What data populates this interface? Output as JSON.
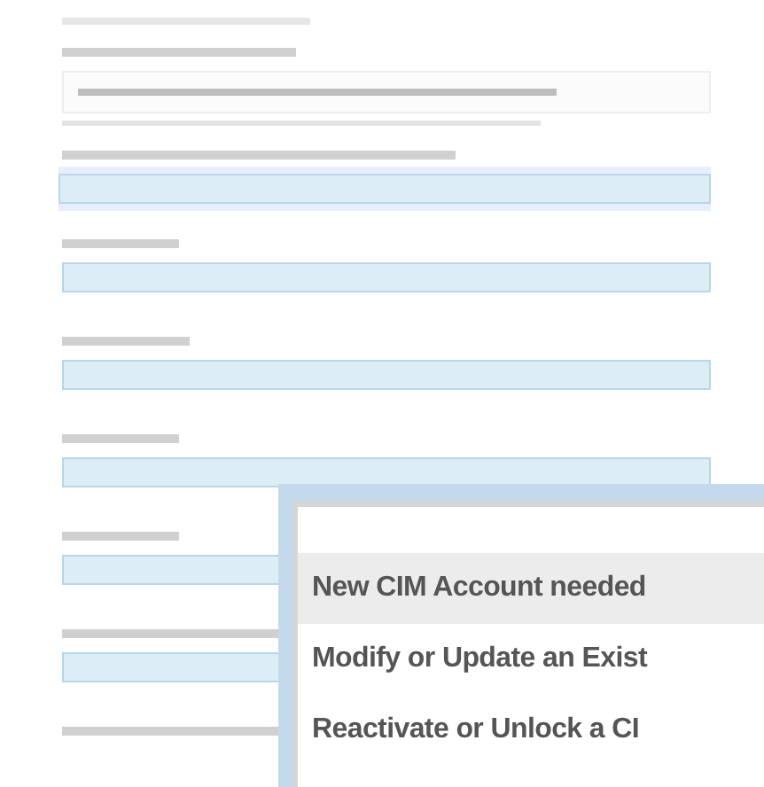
{
  "form": {
    "fields": [
      {
        "kind": "readonly"
      },
      {
        "kind": "focused"
      },
      {
        "kind": "input"
      },
      {
        "kind": "input"
      },
      {
        "kind": "input"
      },
      {
        "kind": "input"
      },
      {
        "kind": "input"
      },
      {
        "kind": "label"
      }
    ]
  },
  "dropdown": {
    "options": [
      {
        "label": "New CIM Account needed",
        "selected": true
      },
      {
        "label": "Modify or Update an Exist",
        "selected": false
      },
      {
        "label": "Reactivate or Unlock a CI",
        "selected": false
      }
    ]
  }
}
